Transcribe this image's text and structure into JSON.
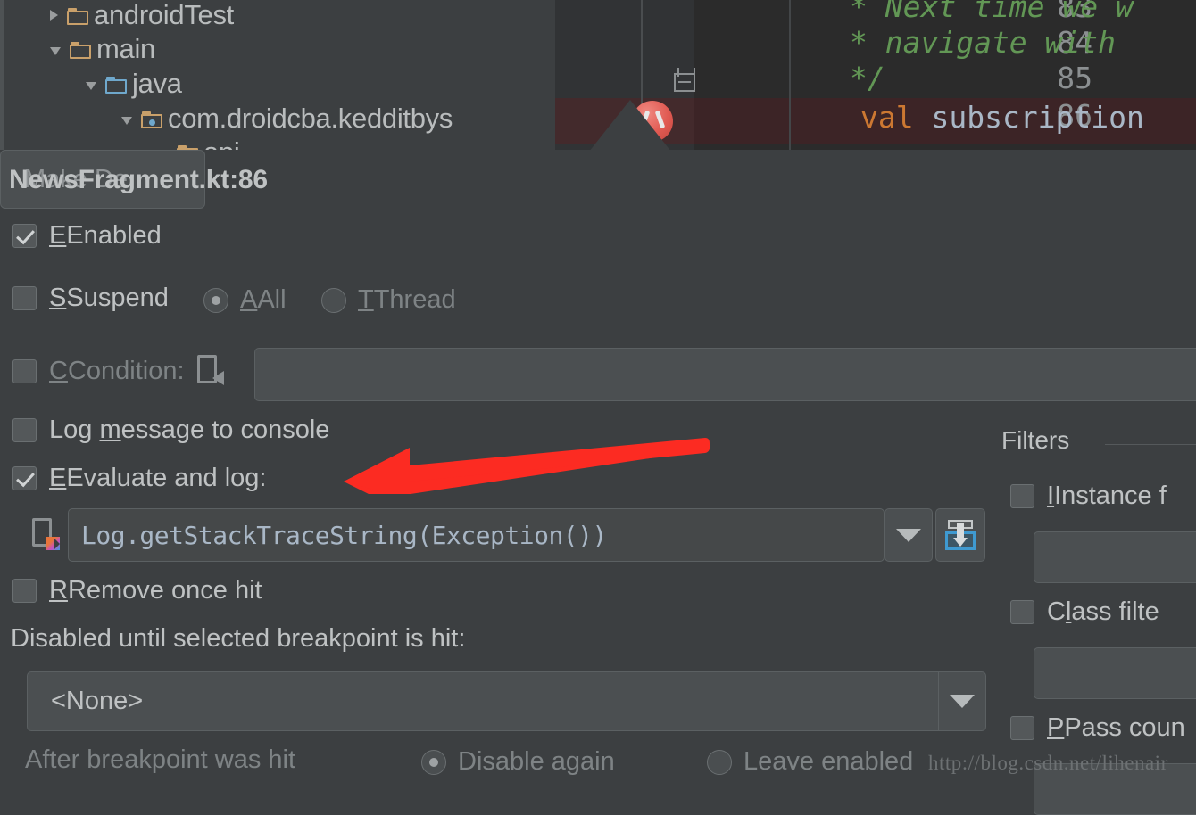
{
  "ide": {
    "project_tree": [
      {
        "label": "androidTest",
        "expanded": false,
        "icon": "folder-icon",
        "indent": 56
      },
      {
        "label": "main",
        "expanded": true,
        "icon": "folder-icon",
        "indent": 56
      },
      {
        "label": "java",
        "expanded": true,
        "icon": "folder-blue-icon",
        "indent": 96
      },
      {
        "label": "com.droidcba.kedditbys",
        "expanded": true,
        "icon": "package-icon",
        "indent": 136
      },
      {
        "label": "api",
        "expanded": true,
        "icon": "package-icon",
        "indent": 176
      }
    ],
    "editor": {
      "line_numbers": [
        "83",
        "84",
        "85",
        "86"
      ],
      "lines": [
        {
          "text": "* Next time we w",
          "type": "comment"
        },
        {
          "text": "* navigate with",
          "type": "comment"
        },
        {
          "text": "*/",
          "type": "comment"
        },
        {
          "text": "val subscription",
          "type": "code",
          "keyword": "val",
          "identifier": " subscription"
        }
      ],
      "breakpoint_line": "86",
      "breakpoint_icon": "breakpoint-icon"
    }
  },
  "dialog": {
    "title": "NewsFragment.kt:86",
    "enabled": {
      "label": "Enabled",
      "mnemonic": "E",
      "checked": true
    },
    "suspend": {
      "label": "Suspend",
      "mnemonic": "S",
      "checked": false
    },
    "suspend_all": {
      "label": "All",
      "mnemonic": "A",
      "selected": true
    },
    "suspend_thread": {
      "label": "Thread",
      "mnemonic": "T",
      "selected": false
    },
    "make_default": {
      "label": "Make De",
      "full_label": "Make Default"
    },
    "condition": {
      "label": "Condition:",
      "mnemonic": "C",
      "checked": false,
      "value": "",
      "icon": "condition-document-icon"
    },
    "log_message": {
      "label": "Log message to console",
      "mnemonic": "m",
      "checked": false
    },
    "evaluate_and_log": {
      "label": "Evaluate and log:",
      "mnemonic": "E",
      "checked": true
    },
    "expression": {
      "value": "Log.getStackTraceString(Exception())",
      "file_icon": "kotlin-file-icon",
      "dropdown_icon": "chevron-down-icon",
      "expand_icon": "expand-editor-icon"
    },
    "remove_once_hit": {
      "label": "Remove once hit",
      "mnemonic": "R",
      "checked": false
    },
    "disabled_until": {
      "label": "Disabled until selected breakpoint is hit:",
      "selected": "<None>",
      "dropdown_icon": "chevron-down-icon"
    },
    "after_hit": {
      "label": "After breakpoint was hit",
      "disable_again": {
        "label": "Disable again",
        "selected": true
      },
      "leave_enabled": {
        "label": "Leave enabled",
        "selected": false
      }
    },
    "filters": {
      "title": "Filters",
      "instance": {
        "label": "Instance f",
        "full_label": "Instance filters",
        "mnemonic": "I",
        "checked": false,
        "value": ""
      },
      "class": {
        "label": "Class filte",
        "full_label": "Class filters",
        "mnemonic": "l",
        "checked": false,
        "value": ""
      },
      "pass_count": {
        "label": "Pass coun",
        "full_label": "Pass count",
        "mnemonic": "P",
        "checked": false,
        "value": ""
      }
    }
  },
  "annotation": {
    "arrow_color": "#fc2b22",
    "arrow_direction": "left"
  },
  "watermark": {
    "text": "http://blog.csdn.net/lihenair"
  },
  "colors": {
    "dialog_bg": "#3c3f41",
    "editor_bg": "#2b2b2b",
    "gutter_bg": "#313335",
    "breakpoint_line_bg": "#3c2426",
    "keyword": "#cc7832",
    "comment": "#629755",
    "identifier": "#a9b7c6",
    "text": "#bfc2c3",
    "disabled_text": "#7e8385"
  }
}
